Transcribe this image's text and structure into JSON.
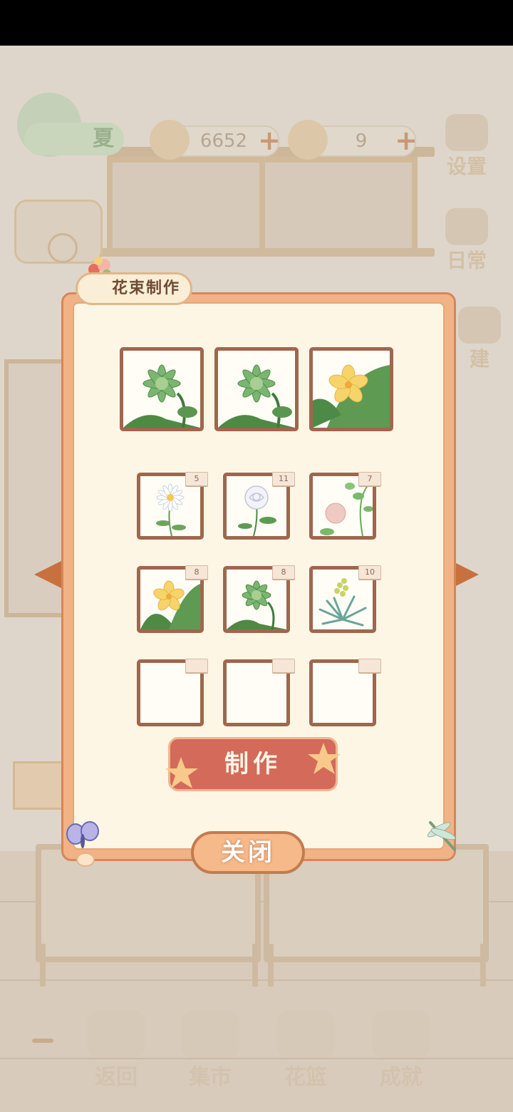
{
  "hud": {
    "season": "夏",
    "fish_count": "6652",
    "cheese_count": "9",
    "settings_label": "设置",
    "daily_label": "日常",
    "build_label": "建"
  },
  "dialog": {
    "title": "花束制作",
    "make_label": "制作",
    "close_label": "关闭",
    "bouquet_slots": [
      {
        "flower": "green-star-flower"
      },
      {
        "flower": "green-star-flower"
      },
      {
        "flower": "yellow-frangipani"
      }
    ],
    "inventory": [
      {
        "flower": "daisy",
        "count": "5"
      },
      {
        "flower": "white-rose",
        "count": "11"
      },
      {
        "flower": "pink-bud-vine",
        "count": "7"
      },
      {
        "flower": "yellow-frangipani",
        "count": "8"
      },
      {
        "flower": "green-star-flower",
        "count": "8"
      },
      {
        "flower": "yellow-fern-plant",
        "count": "10"
      },
      {
        "flower": "empty",
        "count": ""
      },
      {
        "flower": "empty",
        "count": ""
      },
      {
        "flower": "empty",
        "count": ""
      }
    ]
  },
  "bottom_nav": {
    "back": "返回",
    "market": "集市",
    "basket": "花篮",
    "achievements": "成就"
  },
  "colors": {
    "panel_border": "#f1b386",
    "panel_fill": "#fdf6e4",
    "make_button": "#d36a5a",
    "arrow": "#c8703e"
  }
}
